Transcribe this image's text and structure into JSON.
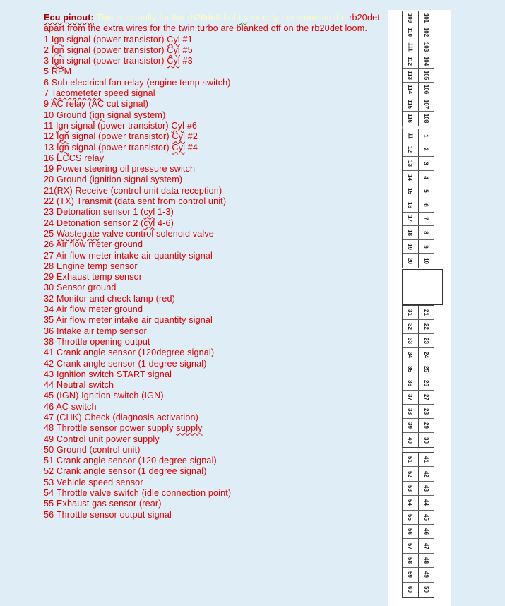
{
  "document": {
    "heading": "Ecu pinout:",
    "intro_faint_before": " This is actually for the rb26dett but ",
    "intro_faint_misspelled": "its",
    "intro_faint_after": " exactly the same as the",
    "intro_red": "rb20det apart from the extra wires for the twin turbo are blanked off on the rb20det loom.",
    "text_color": "#e00000",
    "heading_color": "#a50000",
    "faint_color": "#fdfcc0",
    "background_color": "#deedf6",
    "pins": [
      {
        "pre": "1 ",
        "sq1": "Ign",
        "mid": " signal (power transistor) ",
        "sq2": "Cyl",
        "post": " #1"
      },
      {
        "pre": "2 ",
        "sq1": "Ign",
        "mid": " signal (power transistor) ",
        "sq2": "Cyl",
        "post": " #5"
      },
      {
        "pre": "3 ",
        "sq1": "Ign",
        "mid": " signal (power transistor) ",
        "sq2": "Cyl",
        "post": " #3"
      },
      {
        "pre": "5 RPM",
        "sq1": "",
        "mid": "",
        "sq2": "",
        "post": ""
      },
      {
        "pre": "6 Sub electrical fan relay (engine temp switch)",
        "sq1": "",
        "mid": "",
        "sq2": "",
        "post": ""
      },
      {
        "pre": "7 ",
        "sq1": "Tacometeter",
        "mid": " speed signal",
        "sq2": "",
        "post": ""
      },
      {
        "pre": "9 AC relay (AC cut signal)",
        "sq1": "",
        "mid": "",
        "sq2": "",
        "post": ""
      },
      {
        "pre": "10 Ground (",
        "sq1": "ign",
        "mid": " signal system)",
        "sq2": "",
        "post": ""
      },
      {
        "pre": "11 ",
        "sq1": "Ign",
        "mid": " signal (power transistor) ",
        "sq2": "Cyl",
        "post": " #6"
      },
      {
        "pre": "12 ",
        "sq1": "Ign",
        "mid": " signal (power transistor) ",
        "sq2": "Cyl",
        "post": " #2"
      },
      {
        "pre": "13 ",
        "sq1": "Ign",
        "mid": " signal (power transistor) ",
        "sq2": "Cyl",
        "post": " #4"
      },
      {
        "pre": "16 ECCS relay",
        "sq1": "",
        "mid": "",
        "sq2": "",
        "post": ""
      },
      {
        "pre": "19 Power steering oil pressure switch",
        "sq1": "",
        "mid": "",
        "sq2": "",
        "post": ""
      },
      {
        "pre": "20 Ground (ignition signal system)",
        "sq1": "",
        "mid": "",
        "sq2": "",
        "post": ""
      },
      {
        "pre": "21(RX) Receive (control unit data reception)",
        "sq1": "",
        "mid": "",
        "sq2": "",
        "post": ""
      },
      {
        "pre": "22 (TX) Transmit (data sent from control unit)",
        "sq1": "",
        "mid": "",
        "sq2": "",
        "post": ""
      },
      {
        "pre": "23 Detonation sensor 1 (",
        "sq1": "cyl",
        "mid": " 1-3)",
        "sq2": "",
        "post": ""
      },
      {
        "pre": "24 Detonation sensor 2 (",
        "sq1": "cyl",
        "mid": " 4-6)",
        "sq2": "",
        "post": ""
      },
      {
        "pre": "25 ",
        "sq1": "Wastegate",
        "mid": " valve control solenoid valve",
        "sq2": "",
        "post": ""
      },
      {
        "pre": "26 Air flow meter ground",
        "sq1": "",
        "mid": "",
        "sq2": "",
        "post": ""
      },
      {
        "pre": "27 Air flow meter intake air quantity signal",
        "sq1": "",
        "mid": "",
        "sq2": "",
        "post": ""
      },
      {
        "pre": "28 Engine temp sensor",
        "sq1": "",
        "mid": "",
        "sq2": "",
        "post": ""
      },
      {
        "pre": "29 Exhaust temp sensor",
        "sq1": "",
        "mid": "",
        "sq2": "",
        "post": ""
      },
      {
        "pre": "30 Sensor ground",
        "sq1": "",
        "mid": "",
        "sq2": "",
        "post": ""
      },
      {
        "pre": "32 Monitor and check lamp (red)",
        "sq1": "",
        "mid": "",
        "sq2": "",
        "post": ""
      },
      {
        "pre": "34 Air flow meter ground",
        "sq1": "",
        "mid": "",
        "sq2": "",
        "post": ""
      },
      {
        "pre": "35 Air flow meter intake air quantity signal",
        "sq1": "",
        "mid": "",
        "sq2": "",
        "post": ""
      },
      {
        "pre": "36 Intake air temp sensor",
        "sq1": "",
        "mid": "",
        "sq2": "",
        "post": ""
      },
      {
        "pre": "38 Throttle opening output",
        "sq1": "",
        "mid": "",
        "sq2": "",
        "post": ""
      },
      {
        "pre": "41 Crank angle sensor (120degree signal)",
        "sq1": "",
        "mid": "",
        "sq2": "",
        "post": ""
      },
      {
        "pre": "42 Crank angle sensor (1 degree signal)",
        "sq1": "",
        "mid": "",
        "sq2": "",
        "post": ""
      },
      {
        "pre": "43 Ignition switch START signal",
        "sq1": "",
        "mid": "",
        "sq2": "",
        "post": ""
      },
      {
        "pre": "44 Neutral switch",
        "sq1": "",
        "mid": "",
        "sq2": "",
        "post": ""
      },
      {
        "pre": "45 (IGN) Ignition switch (IGN)",
        "sq1": "",
        "mid": "",
        "sq2": "",
        "post": ""
      },
      {
        "pre": "46 AC switch",
        "sq1": "",
        "mid": "",
        "sq2": "",
        "post": ""
      },
      {
        "pre": "47 (CHK) Check (diagnosis activation)",
        "sq1": "",
        "mid": "",
        "sq2": "",
        "post": ""
      },
      {
        "pre": "48 Throttle sensor power supply ",
        "sq1": "supply",
        "mid": "",
        "sq2": "",
        "post": ""
      },
      {
        "pre": "49 Control unit power supply",
        "sq1": "",
        "mid": "",
        "sq2": "",
        "post": ""
      },
      {
        "pre": "50 Ground (control unit)",
        "sq1": "",
        "mid": "",
        "sq2": "",
        "post": ""
      },
      {
        "pre": "51 Crank angle sensor (120 degree signal)",
        "sq1": "",
        "mid": "",
        "sq2": "",
        "post": ""
      },
      {
        "pre": "52 Crank angle sensor (1 degree signal)",
        "sq1": "",
        "mid": "",
        "sq2": "",
        "post": ""
      },
      {
        "pre": "53 Vehicle speed sensor",
        "sq1": "",
        "mid": "",
        "sq2": "",
        "post": ""
      },
      {
        "pre": "54 Throttle valve switch (idle connection point)",
        "sq1": "",
        "mid": "",
        "sq2": "",
        "post": ""
      },
      {
        "pre": "55 Exhaust gas sensor (rear)",
        "sq1": "",
        "mid": "",
        "sq2": "",
        "post": ""
      },
      {
        "pre": "56 Throttle sensor output signal",
        "sq1": "",
        "mid": "",
        "sq2": "",
        "post": ""
      }
    ]
  },
  "connector": {
    "blocks": [
      {
        "rows": [
          [
            "109",
            "101"
          ],
          [
            "110",
            "102"
          ],
          [
            "111",
            "103"
          ],
          [
            "112",
            "104"
          ],
          [
            "113",
            "105"
          ],
          [
            "114",
            "106"
          ],
          [
            "115",
            "107"
          ],
          [
            "116",
            "108"
          ]
        ]
      },
      {
        "rows": [
          [
            "11",
            "1"
          ],
          [
            "12",
            "2"
          ],
          [
            "13",
            "3"
          ],
          [
            "14",
            "4"
          ],
          [
            "15",
            "5"
          ],
          [
            "16",
            "6"
          ],
          [
            "17",
            "7"
          ],
          [
            "18",
            "8"
          ],
          [
            "19",
            "9"
          ],
          [
            "20",
            "10"
          ]
        ]
      },
      {
        "rows": [
          [
            "31",
            "21"
          ],
          [
            "32",
            "22"
          ],
          [
            "33",
            "23"
          ],
          [
            "34",
            "24"
          ],
          [
            "35",
            "25"
          ],
          [
            "36",
            "26"
          ],
          [
            "37",
            "27"
          ],
          [
            "38",
            "28"
          ],
          [
            "39",
            "29"
          ],
          [
            "40",
            "30"
          ]
        ]
      },
      {
        "rows": [
          [
            "51",
            "41"
          ],
          [
            "52",
            "42"
          ],
          [
            "53",
            "43"
          ],
          [
            "54",
            "44"
          ],
          [
            "55",
            "45"
          ],
          [
            "56",
            "46"
          ],
          [
            "57",
            "47"
          ],
          [
            "58",
            "48"
          ],
          [
            "59",
            "49"
          ],
          [
            "60",
            "50"
          ]
        ]
      }
    ]
  }
}
